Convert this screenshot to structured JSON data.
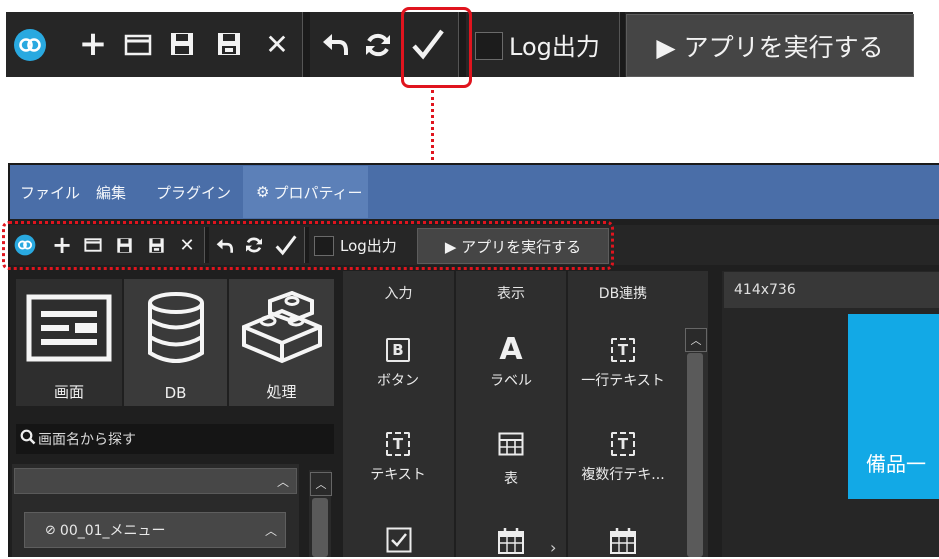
{
  "toolbar": {
    "log_label": "Log出力",
    "run_label": "▶ アプリを実行する"
  },
  "menubar": {
    "items": [
      "ファイル",
      "編集",
      "プラグイン"
    ],
    "properties_label": "プロパティー"
  },
  "categories": [
    {
      "label": "画面",
      "icon": "screen-icon"
    },
    {
      "label": "DB",
      "icon": "database-icon"
    },
    {
      "label": "処理",
      "icon": "blocks-icon"
    }
  ],
  "search": {
    "placeholder": "画面名から探す"
  },
  "tree": {
    "item_label": "00_01_メニュー"
  },
  "palette": {
    "columns": [
      "入力",
      "表示",
      "DB連携"
    ],
    "components": [
      {
        "label": "ボタン",
        "icon": "button-icon",
        "glyph": "B"
      },
      {
        "label": "ラベル",
        "icon": "label-icon",
        "glyph": "A"
      },
      {
        "label": "一行テキスト",
        "icon": "single-text-icon",
        "glyph": "T"
      },
      {
        "label": "テキスト",
        "icon": "text-icon",
        "glyph": "T"
      },
      {
        "label": "表",
        "icon": "table-icon",
        "glyph": ""
      },
      {
        "label": "複数行テキ...",
        "icon": "multiline-text-icon",
        "glyph": "T"
      }
    ]
  },
  "canvas": {
    "size_label": "414x736",
    "preview_text": "備品一"
  },
  "colors": {
    "menubar": "#4a6ea8",
    "toolbar": "#262626",
    "highlight": "#e0141e",
    "preview": "#12a9e6"
  }
}
